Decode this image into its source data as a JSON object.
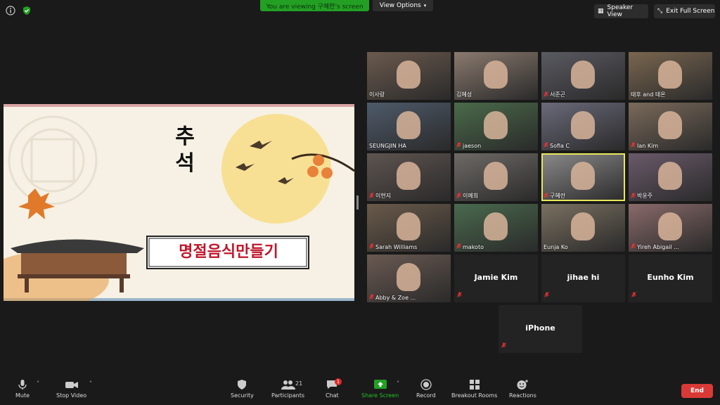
{
  "topbar": {
    "viewing_banner": "You are viewing 구혜란's screen",
    "view_options": "View Options",
    "speaker_view": "Speaker View",
    "exit_full_screen": "Exit Full Screen"
  },
  "slide": {
    "title_vertical": "추석",
    "subtitle": "명절음식만들기"
  },
  "participants": [
    {
      "name": "이사랑",
      "muted": false
    },
    {
      "name": "김혜성",
      "muted": false
    },
    {
      "name": "서준곤",
      "muted": true
    },
    {
      "name": "태후 and 태온",
      "muted": false
    },
    {
      "name": "SEUNGJIN HA",
      "muted": false
    },
    {
      "name": "jaeson",
      "muted": true
    },
    {
      "name": "Sofia C",
      "muted": true
    },
    {
      "name": "Ian Kim",
      "muted": true
    },
    {
      "name": "이현지",
      "muted": true
    },
    {
      "name": "이예희",
      "muted": true
    },
    {
      "name": "구혜란",
      "muted": true
    },
    {
      "name": "박윤주",
      "muted": true
    },
    {
      "name": "Sarah Williams",
      "muted": true
    },
    {
      "name": "makoto",
      "muted": true
    },
    {
      "name": "Eunja Ko",
      "muted": false
    },
    {
      "name": "Yireh Abigail ...",
      "muted": true
    },
    {
      "name": "Abby & Zoe ...",
      "muted": true
    },
    {
      "name": "Jamie Kim",
      "muted": true
    },
    {
      "name": "jihae hi",
      "muted": true
    },
    {
      "name": "Eunho Kim",
      "muted": true
    },
    {
      "name": "iPhone",
      "muted": true
    }
  ],
  "toolbar": {
    "mute": "Mute",
    "stop_video": "Stop Video",
    "security": "Security",
    "participants": "Participants",
    "participants_count": "21",
    "chat": "Chat",
    "chat_badge": "1",
    "share_screen": "Share Screen",
    "record": "Record",
    "breakout_rooms": "Breakout Rooms",
    "reactions": "Reactions",
    "end": "End"
  },
  "colors": {
    "share_green": "#23a024",
    "end_red": "#d93a36",
    "active_speaker": "#e9e75a"
  }
}
